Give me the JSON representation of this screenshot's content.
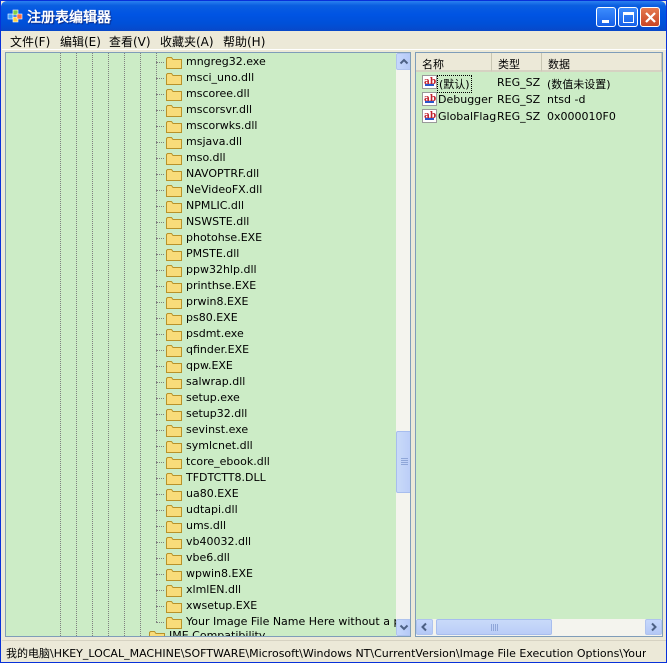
{
  "window": {
    "title": "注册表编辑器"
  },
  "menu": [
    "文件(F)",
    "编辑(E)",
    "查看(V)",
    "收藏夹(A)",
    "帮助(H)"
  ],
  "tree": {
    "items": [
      "mngreg32.exe",
      "msci_uno.dll",
      "mscoree.dll",
      "mscorsvr.dll",
      "mscorwks.dll",
      "msjava.dll",
      "mso.dll",
      "NAVOPTRF.dll",
      "NeVideoFX.dll",
      "NPMLIC.dll",
      "NSWSTE.dll",
      "photohse.EXE",
      "PMSTE.dll",
      "ppw32hlp.dll",
      "printhse.EXE",
      "prwin8.EXE",
      "ps80.EXE",
      "psdmt.exe",
      "qfinder.EXE",
      "qpw.EXE",
      "salwrap.dll",
      "setup.exe",
      "setup32.dll",
      "sevinst.exe",
      "symlcnet.dll",
      "tcore_ebook.dll",
      "TFDTCTT8.DLL",
      "ua80.EXE",
      "udtapi.dll",
      "ums.dll",
      "vb40032.dll",
      "vbe6.dll",
      "wpwin8.EXE",
      "xlmlEN.dll",
      "xwsetup.EXE",
      "Your Image File Name Here without a path"
    ],
    "partial_item": "IME Compatibility"
  },
  "list": {
    "headers": {
      "name": "名称",
      "type": "类型",
      "data": "数据"
    },
    "rows": [
      {
        "name": "(默认)",
        "type": "REG_SZ",
        "data": "(数值未设置)",
        "icon": "string-value-icon"
      },
      {
        "name": "Debugger",
        "type": "REG_SZ",
        "data": "ntsd -d",
        "icon": "string-value-icon"
      },
      {
        "name": "GlobalFlag",
        "type": "REG_SZ",
        "data": "0x000010F0",
        "icon": "string-value-icon"
      }
    ]
  },
  "status": {
    "path": "我的电脑\\HKEY_LOCAL_MACHINE\\SOFTWARE\\Microsoft\\Windows NT\\CurrentVersion\\Image File Execution Options\\Your Image File"
  },
  "colors": {
    "pane_background": "#ccecc6",
    "titlebar": "#0054e3",
    "selection_outline": "#000000"
  }
}
